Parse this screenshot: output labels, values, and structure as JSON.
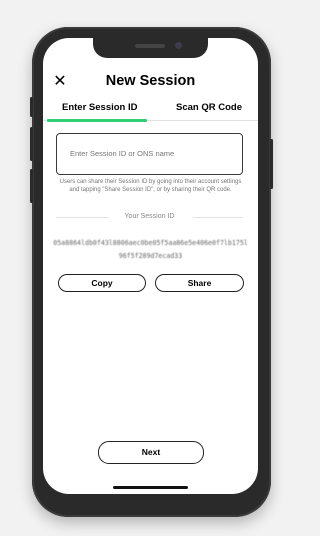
{
  "header": {
    "title": "New Session",
    "close_glyph": "✕"
  },
  "tabs": [
    {
      "label": "Enter Session ID",
      "active": true
    },
    {
      "label": "Scan QR Code",
      "active": false
    }
  ],
  "input": {
    "placeholder": "Enter Session ID or ONS name",
    "value": ""
  },
  "help_text": "Users can share their Session ID by going into their account settings and tapping \"Share Session ID\", or by sharing their QR code.",
  "your_session_id": {
    "label": "Your Session ID",
    "value": "05a8864ldb0f43l8806aec0be05f5aa86e5e406e0f7lb175l96f5f289d7ecad33"
  },
  "buttons": {
    "copy": "Copy",
    "share": "Share",
    "next": "Next"
  },
  "colors": {
    "accent": "#2fcf76",
    "background": "#ffffff",
    "phone_frame": "#2a2a2a"
  }
}
